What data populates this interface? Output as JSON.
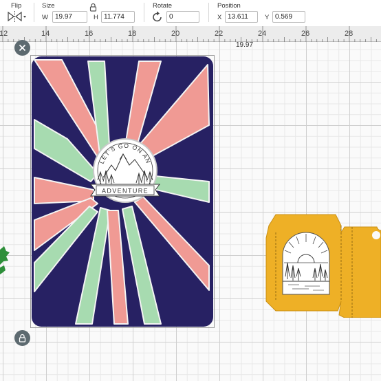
{
  "toolbar": {
    "flip": {
      "label": "Flip"
    },
    "size": {
      "label": "Size",
      "w_axis": "W",
      "w_value": "19.97",
      "h_axis": "H",
      "h_value": "11.774"
    },
    "rotate": {
      "label": "Rotate",
      "value": "0"
    },
    "position": {
      "label": "Position",
      "x_axis": "X",
      "x_value": "13.611",
      "y_axis": "Y",
      "y_value": "0.569"
    }
  },
  "ruler": {
    "numbers": [
      "12",
      "14",
      "16",
      "18",
      "20",
      "22",
      "24",
      "26",
      "28"
    ]
  },
  "canvas": {
    "width_label": "19.97",
    "card": {
      "top_text": "LET'S GO ON AN",
      "banner_text": "ADVENTURE"
    }
  },
  "colors": {
    "card_navy": "#272163",
    "ray_pink": "#f09a94",
    "ray_mint": "#a7dbb0",
    "envelope_yellow": "#eeb026",
    "button_gray": "#5d6a70"
  },
  "icons": {
    "flip": "flip-icon",
    "size_lock": "lock-icon",
    "rotate": "rotate-icon",
    "close": "close-icon",
    "lock": "lock-icon"
  }
}
